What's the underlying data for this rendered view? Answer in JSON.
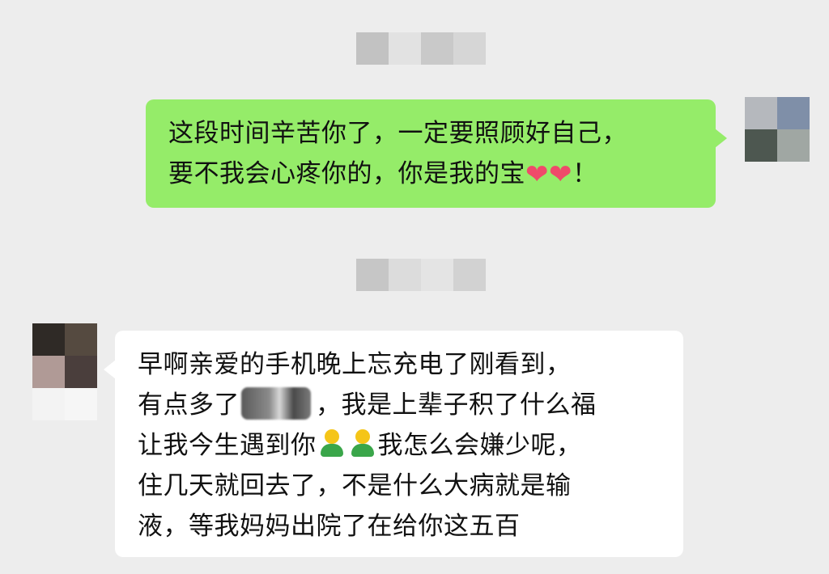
{
  "conversation": {
    "outgoing_message": {
      "line1": "这段时间辛苦你了，一定要照顾好自己，",
      "line2_text": "要不我会心疼你的，你是我的宝",
      "line2_end": "！",
      "hearts": [
        "heart-icon",
        "heart-icon"
      ]
    },
    "incoming_message": {
      "line1": "早啊亲爱的手机晚上忘充电了刚看到，",
      "line2_a": "有点多了",
      "line2_b": "，我是上辈子积了什么福",
      "line3_a": "让我今生遇到你",
      "line3_b": "我怎么会嫌少呢，",
      "line4": "住几天就回去了，不是什么大病就是输",
      "line5": "液，等我妈妈出院了在给你这五百"
    }
  },
  "colors": {
    "background": "#ededed",
    "outgoing_bubble": "#95ec69",
    "incoming_bubble": "#ffffff",
    "heart": "#ef4a6a"
  }
}
